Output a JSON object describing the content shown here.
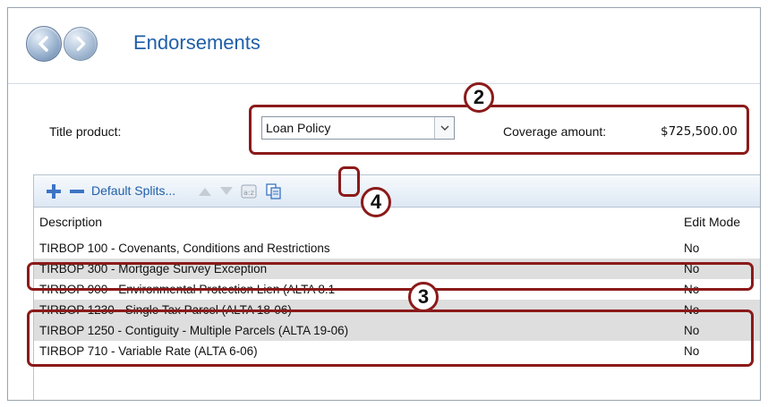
{
  "header": {
    "title": "Endorsements",
    "back_icon": "back-arrow-icon",
    "forward_icon": "forward-arrow-icon"
  },
  "product": {
    "title_product_label": "Title product:",
    "title_product_value": "Loan Policy",
    "coverage_label": "Coverage amount:",
    "coverage_value": "$725,500.00"
  },
  "toolbar": {
    "add_icon": "plus-icon",
    "remove_icon": "minus-icon",
    "splits_label": "Default Splits...",
    "up_icon": "move-up-icon",
    "down_icon": "move-down-icon",
    "sort_icon": "sort-az-icon",
    "copy_icon": "copy-icon"
  },
  "table": {
    "columns": [
      "Description",
      "Edit Mode"
    ],
    "rows": [
      {
        "description": "TIRBOP 100 - Covenants, Conditions and Restrictions",
        "edit_mode": "No",
        "selected": false
      },
      {
        "description": "TIRBOP 300 - Mortgage Survey Exception",
        "edit_mode": "No",
        "selected": true
      },
      {
        "description": "TIRBOP 900 - Environmental Protection Lien (ALTA 8.1",
        "edit_mode": "No",
        "selected": false
      },
      {
        "description": "TIRBOP 1230 - Single Tax Parcel (ALTA 18-06)",
        "edit_mode": "No",
        "selected": true
      },
      {
        "description": "TIRBOP 1250 - Contiguity - Multiple Parcels (ALTA 19-06)",
        "edit_mode": "No",
        "selected": true
      },
      {
        "description": "TIRBOP 710 - Variable Rate (ALTA 6-06)",
        "edit_mode": "No",
        "selected": false
      }
    ]
  },
  "callouts": {
    "badge_2": "2",
    "badge_3": "3",
    "badge_4": "4",
    "color": "#8b1a1a"
  },
  "colors": {
    "accent": "#1f5fa8",
    "selected_row": "#dedede"
  }
}
